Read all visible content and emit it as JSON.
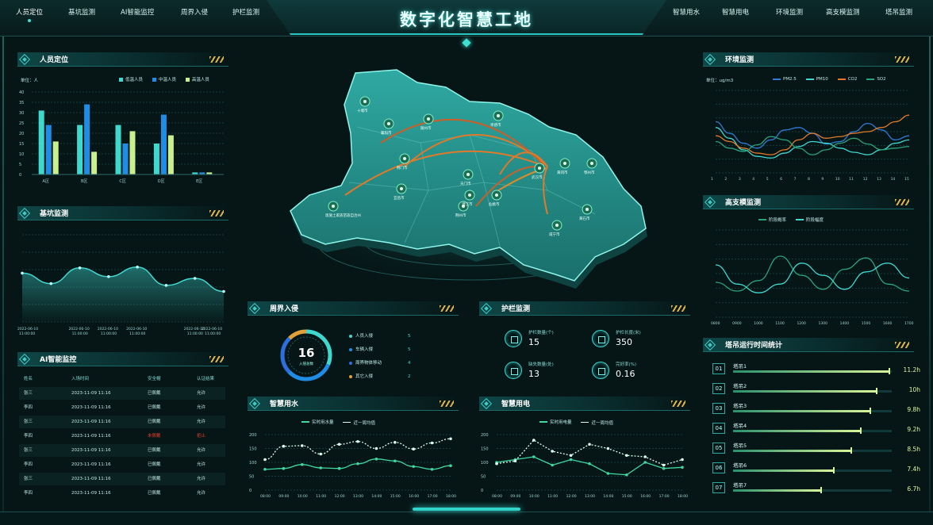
{
  "header": {
    "title": "数字化智慧工地",
    "nav_left": [
      "人员定位",
      "基坑监测",
      "AI智能监控",
      "周界入侵",
      "护栏监测"
    ],
    "nav_right": [
      "智慧用水",
      "智慧用电",
      "环境监测",
      "高支模监测",
      "塔吊监测"
    ],
    "active_nav": "人员定位"
  },
  "colors": {
    "accent": "#3fd8cf",
    "orange": "#e07a2a",
    "lime": "#c9ef8f",
    "blue": "#1f8de6",
    "red": "#e0402a"
  },
  "personnel": {
    "title": "人员定位",
    "unit": "单位：人",
    "legend": [
      "低温人员",
      "中温人员",
      "高温人员"
    ],
    "chart_data": {
      "type": "bar",
      "categories": [
        "A区",
        "B区",
        "C区",
        "D区",
        "E区"
      ],
      "ylim": [
        0,
        40
      ],
      "yticks": [
        "0",
        "5",
        "10",
        "15",
        "20",
        "25",
        "30",
        "35",
        "40"
      ],
      "series": [
        {
          "name": "低温人员",
          "values": [
            31,
            24,
            24,
            15,
            1
          ]
        },
        {
          "name": "中温人员",
          "values": [
            24,
            34,
            15,
            29,
            1
          ]
        },
        {
          "name": "高温人员",
          "values": [
            16,
            11,
            21,
            19,
            1
          ]
        }
      ]
    }
  },
  "foundation": {
    "title": "基坑监测",
    "chart_data": {
      "type": "area",
      "x": [
        "2022-06-10 11:00:00",
        "2022-06-10 11:00:00",
        "2022-06-10 11:00:00",
        "2022-06-10 11:00:00",
        "2022-06-10 11:00:00",
        "2022-06-10 11:00:00",
        "2022-06-10 11:00:00",
        "2022-06-10 11:00:00"
      ],
      "values": [
        56,
        44,
        62,
        52,
        63,
        42,
        50,
        35
      ],
      "ylim": [
        0,
        100
      ]
    }
  },
  "ai_monitor": {
    "title": "AI智能监控",
    "columns": [
      "姓名",
      "入场时间",
      "安全帽",
      "认证结果"
    ],
    "rows": [
      [
        "张三",
        "2023-11-09 11:16",
        "已佩戴",
        "允许"
      ],
      [
        "李四",
        "2023-11-09 11:16",
        "已佩戴",
        "允许"
      ],
      [
        "张三",
        "2023-11-09 11:16",
        "已佩戴",
        "允许"
      ],
      [
        "李四",
        "2023-11-09 11:16",
        "未佩戴",
        "拒止"
      ],
      [
        "张三",
        "2023-11-09 11:16",
        "已佩戴",
        "允许"
      ],
      [
        "李四",
        "2023-11-09 11:16",
        "已佩戴",
        "允许"
      ],
      [
        "张三",
        "2023-11-09 11:16",
        "已佩戴",
        "允许"
      ],
      [
        "李四",
        "2023-11-09 11:16",
        "已佩戴",
        "允许"
      ]
    ],
    "alert_row": 3
  },
  "perimeter": {
    "title": "周界入侵",
    "total": "16",
    "total_label": "入侵总数",
    "items": [
      {
        "label": "人员入侵",
        "value": "5",
        "color": "#3fd8cf"
      },
      {
        "label": "车辆入侵",
        "value": "5",
        "color": "#1f8de6"
      },
      {
        "label": "周界物体移动",
        "value": "4",
        "color": "#2b6fe0"
      },
      {
        "label": "其它入侵",
        "value": "2",
        "color": "#e0a13a"
      }
    ]
  },
  "railing": {
    "title": "护栏监测",
    "items": [
      {
        "label": "护栏数量(个)",
        "value": "15"
      },
      {
        "label": "护栏长度(米)",
        "value": "350"
      },
      {
        "label": "缺失数量(处)",
        "value": "13"
      },
      {
        "label": "完好率(%)",
        "value": "0.16"
      }
    ]
  },
  "water": {
    "title": "智慧用水",
    "legend": [
      "实时用水量",
      "近一周均值"
    ],
    "chart_data": {
      "type": "line",
      "x": [
        "08:00",
        "09:00",
        "10:00",
        "11:00",
        "12:00",
        "13:00",
        "14:00",
        "15:00",
        "16:00",
        "17:00",
        "18:00"
      ],
      "ylim": [
        0,
        200
      ],
      "yticks": [
        "0",
        "50",
        "100",
        "150",
        "200"
      ],
      "series": [
        {
          "name": "实时用水量",
          "values": [
            75,
            78,
            92,
            80,
            78,
            95,
            112,
            105,
            85,
            75,
            88
          ]
        },
        {
          "name": "近一周均值",
          "values": [
            110,
            158,
            160,
            130,
            165,
            175,
            150,
            172,
            148,
            170,
            185
          ]
        }
      ]
    }
  },
  "power": {
    "title": "智慧用电",
    "legend": [
      "实时用电量",
      "近一周均值"
    ],
    "chart_data": {
      "type": "line",
      "x": [
        "08:00",
        "09:00",
        "10:00",
        "11:00",
        "12:00",
        "13:00",
        "14:00",
        "15:00",
        "16:00",
        "17:00",
        "18:00"
      ],
      "ylim": [
        0,
        200
      ],
      "yticks": [
        "0",
        "50",
        "100",
        "150",
        "200"
      ],
      "series": [
        {
          "name": "实时用电量",
          "values": [
            100,
            110,
            120,
            90,
            110,
            95,
            60,
            55,
            100,
            78,
            82
          ]
        },
        {
          "name": "近一周均值",
          "values": [
            95,
            105,
            180,
            140,
            125,
            165,
            150,
            125,
            120,
            90,
            110
          ]
        }
      ]
    }
  },
  "environment": {
    "title": "环境监测",
    "unit": "单位：ug/m3",
    "legend": [
      "PM2.5",
      "PM10",
      "CO2",
      "SO2"
    ],
    "chart_data": {
      "type": "line",
      "x": [
        "1",
        "2",
        "3",
        "4",
        "5",
        "6",
        "7",
        "8",
        "9",
        "10",
        "11",
        "12",
        "13",
        "14",
        "15"
      ],
      "ylim": [
        0,
        100
      ],
      "series": [
        {
          "name": "PM2.5",
          "values": [
            62,
            48,
            36,
            30,
            40,
            52,
            55,
            48,
            35,
            38,
            50,
            60,
            52,
            40,
            45
          ]
        },
        {
          "name": "PM10",
          "values": [
            55,
            42,
            28,
            20,
            18,
            24,
            32,
            38,
            36,
            30,
            25,
            22,
            28,
            36,
            40
          ]
        },
        {
          "name": "CO2",
          "values": [
            45,
            38,
            30,
            24,
            22,
            28,
            40,
            48,
            42,
            44,
            48,
            50,
            55,
            62,
            70
          ]
        },
        {
          "name": "SO2",
          "values": [
            38,
            30,
            26,
            34,
            44,
            40,
            30,
            22,
            28,
            36,
            42,
            35,
            28,
            30,
            32
          ]
        }
      ]
    }
  },
  "formwork": {
    "title": "高支模监测",
    "legend": [
      "阶段概率",
      "阶段幅度"
    ],
    "chart_data": {
      "type": "line",
      "x": [
        "0800",
        "0900",
        "1000",
        "1100",
        "1200",
        "1300",
        "1400",
        "1500",
        "1600",
        "1700"
      ],
      "ylim": [
        0,
        100
      ],
      "series": [
        {
          "name": "阶段概率",
          "values": [
            40,
            30,
            42,
            70,
            48,
            32,
            55,
            68,
            38,
            30
          ]
        },
        {
          "name": "阶段幅度",
          "values": [
            60,
            38,
            28,
            38,
            62,
            48,
            32,
            52,
            62,
            45
          ]
        }
      ]
    }
  },
  "crane": {
    "title": "塔吊运行时间统计",
    "rows": [
      {
        "no": "01",
        "name": "塔吊1",
        "value": "11.2h",
        "ratio": 0.98
      },
      {
        "no": "02",
        "name": "塔吊2",
        "value": "10h",
        "ratio": 0.9
      },
      {
        "no": "03",
        "name": "塔吊3",
        "value": "9.8h",
        "ratio": 0.86
      },
      {
        "no": "04",
        "name": "塔吊4",
        "value": "9.2h",
        "ratio": 0.8
      },
      {
        "no": "05",
        "name": "塔吊5",
        "value": "8.5h",
        "ratio": 0.74
      },
      {
        "no": "06",
        "name": "塔吊6",
        "value": "7.4h",
        "ratio": 0.63
      },
      {
        "no": "07",
        "name": "塔吊7",
        "value": "6.7h",
        "ratio": 0.55
      }
    ]
  },
  "map": {
    "markers": [
      "十堰市",
      "襄阳市",
      "随州市",
      "孝感市",
      "荆门市",
      "宜昌市",
      "恩施土家族苗族自治州",
      "荆州市",
      "武汉市",
      "黄冈市",
      "鄂州市",
      "黄石市",
      "咸宁市",
      "天门市",
      "潜江市",
      "仙桃市"
    ]
  }
}
